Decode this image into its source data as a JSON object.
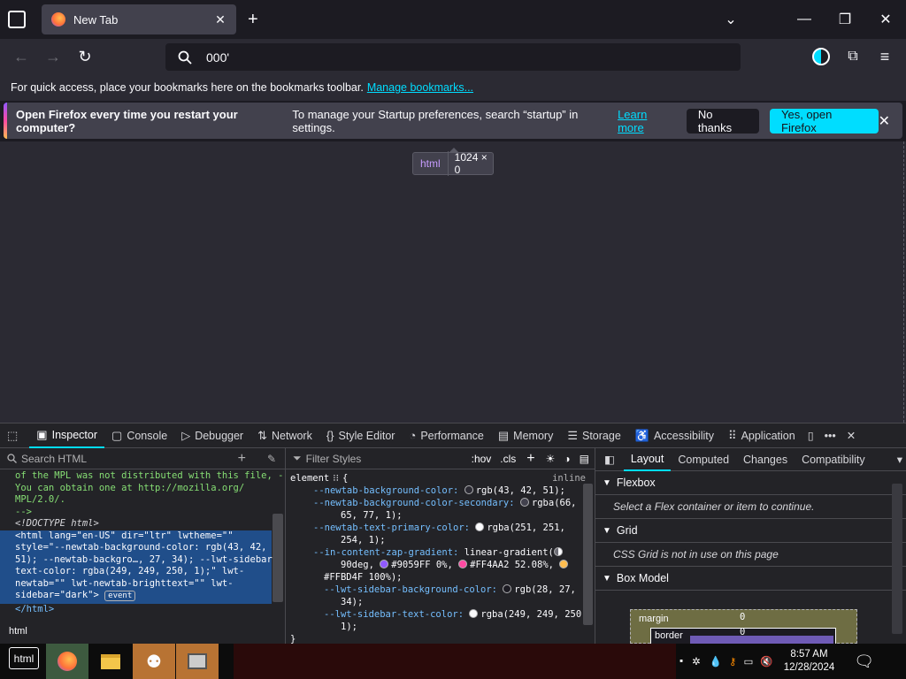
{
  "browser": {
    "tab_title": "New Tab",
    "url_text": "000'",
    "bookmarks_message": "For quick access, place your bookmarks here on the bookmarks toolbar.",
    "manage_bookmarks": "Manage bookmarks...",
    "notification": {
      "bold": "Open Firefox every time you restart your computer?",
      "text": "To manage your Startup preferences, search “startup” in settings.",
      "link": "Learn more",
      "no_button": "No thanks",
      "yes_button": "Yes, open Firefox"
    },
    "tooltip_tag": "html",
    "tooltip_dim": "1024 × 0"
  },
  "devtools": {
    "tabs": [
      {
        "label": "Inspector"
      },
      {
        "label": "Console"
      },
      {
        "label": "Debugger"
      },
      {
        "label": "Network"
      },
      {
        "label": "Style Editor"
      },
      {
        "label": "Performance"
      },
      {
        "label": "Memory"
      },
      {
        "label": "Storage"
      },
      {
        "label": "Accessibility"
      },
      {
        "label": "Application"
      }
    ],
    "search_placeholder": "Search HTML",
    "html_lines": {
      "l1": "of the MPL was not distributed with this file, -",
      "l2": "You can obtain one at http://mozilla.org/",
      "l3": "MPL/2.0/.",
      "l4": "-->",
      "l5": "<!DOCTYPE html>",
      "sel1": "<html lang=\"en-US\" dir=\"ltr\" lwtheme=\"\"",
      "sel2": "style=\"--newtab-background-color: rgb(43, 42,",
      "sel3": "51); --newtab-backgro…, 27, 34); --lwt-sidebar-",
      "sel4": "text-color: rgba(249, 249, 250, 1);\" lwt-",
      "sel5": "newtab=\"\" lwt-newtab-brighttext=\"\" lwt-",
      "sel6": "sidebar=\"dark\">",
      "event_badge": "event",
      "close": "</html>"
    },
    "breadcrumb": "html",
    "styles": {
      "filter_placeholder": "Filter Styles",
      "hov": ":hov",
      "cls": ".cls",
      "selector": "element",
      "brace_open": "{",
      "inline": "inline",
      "r1p": "--newtab-background-color:",
      "r1v": "rgb(43, 42, 51);",
      "r2p": "--newtab-background-color-secondary:",
      "r2v": "rgba(66,",
      "r2v2": "65, 77, 1);",
      "r3p": "--newtab-text-primary-color:",
      "r3v": "rgba(251, 251,",
      "r3v2": "254, 1);",
      "r4p": "--in-content-zap-gradient:",
      "r4v": "linear-gradient(",
      "r4v2": "90deg,",
      "r4v3": "#9059FF 0%,",
      "r4v4": "#FF4AA2 52.08%,",
      "r4v5": "#FFBD4F 100%);",
      "r5p": "--lwt-sidebar-background-color:",
      "r5v": "rgb(28, 27,",
      "r5v2": "34);",
      "r6p": "--lwt-sidebar-text-color:",
      "r6v": "rgba(249, 249, 250,",
      "r6v2": "1);",
      "brace_close": "}"
    },
    "layout": {
      "tabs": [
        "Layout",
        "Computed",
        "Changes",
        "Compatibility"
      ],
      "flexbox": "Flexbox",
      "flexbox_msg": "Select a Flex container or item to continue.",
      "grid": "Grid",
      "grid_msg": "CSS Grid is not in use on this page",
      "boxmodel": "Box Model",
      "margin_label": "margin",
      "border_label": "border",
      "margin_value": "0",
      "border_value": "0"
    }
  },
  "taskbar": {
    "time": "8:57 AM",
    "date": "12/28/2024",
    "html_icon_label": "html"
  }
}
